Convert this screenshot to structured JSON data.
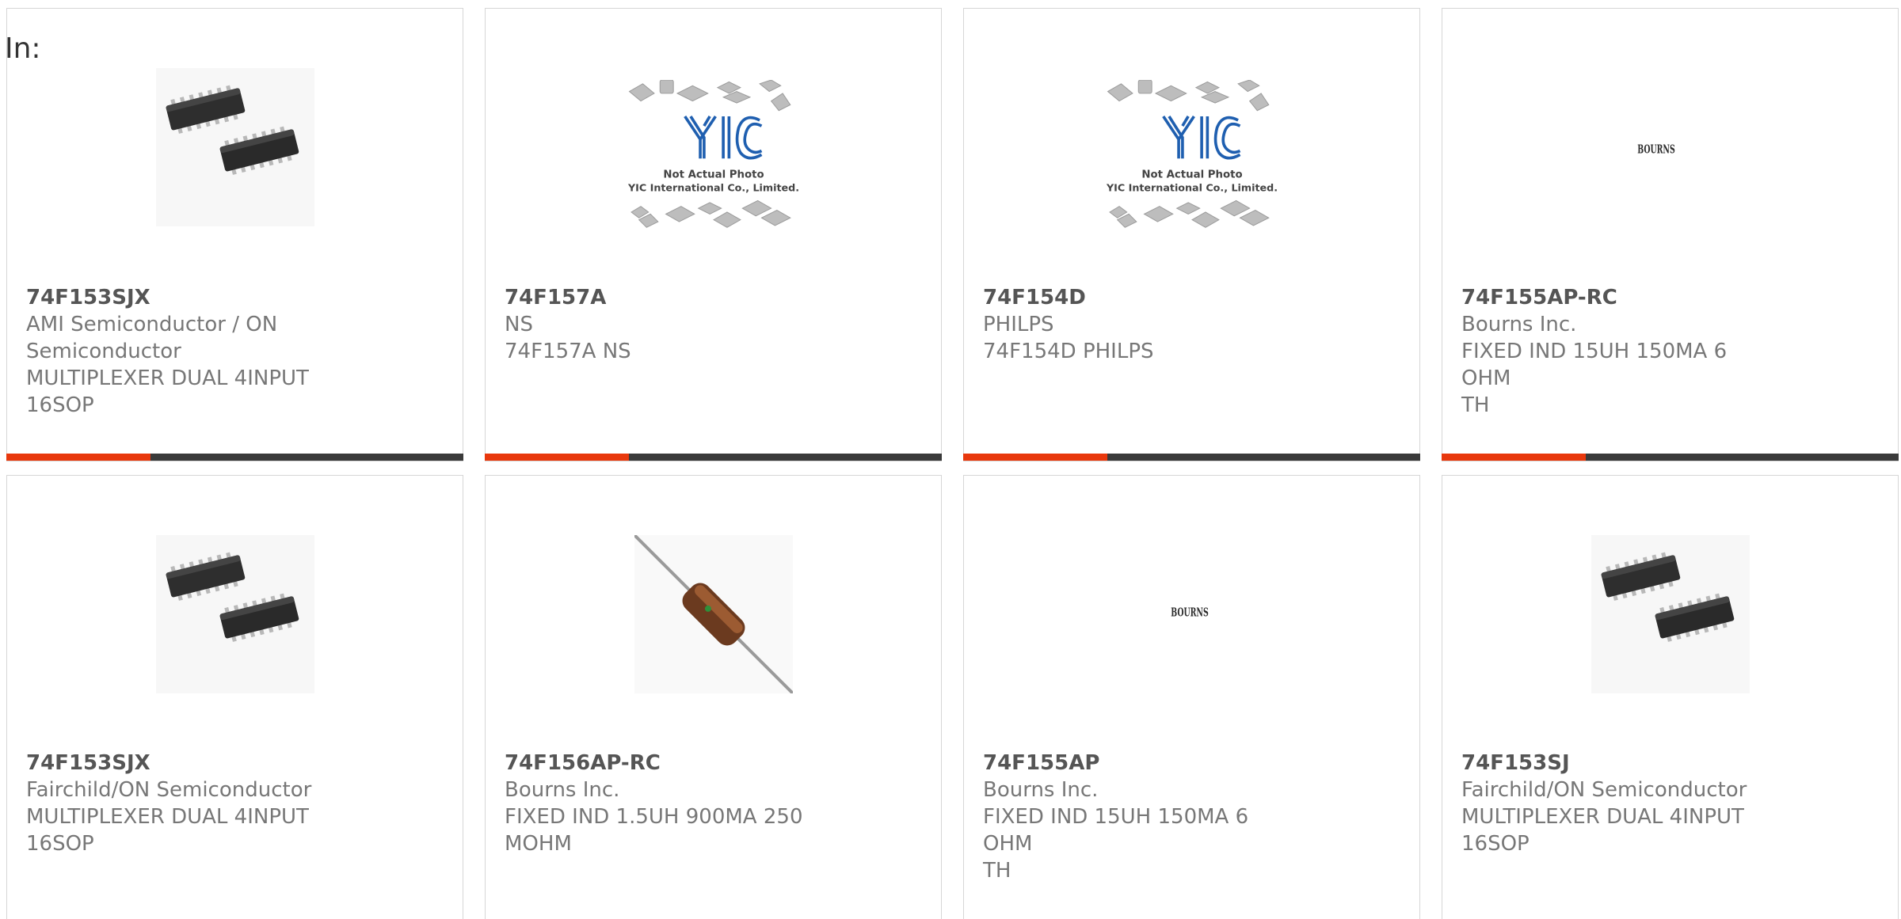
{
  "page": {
    "in_label": "In:"
  },
  "colors": {
    "accent": "#e8380d",
    "bar_dark": "#3a3a3a",
    "card_border": "#d6d6d6",
    "text_gray": "#777777"
  },
  "products": [
    {
      "part_number": "74F153SJX",
      "manufacturer_lines": [
        "AMI Semiconductor / ON",
        "Semiconductor"
      ],
      "description_lines": [
        "MULTIPLEXER DUAL 4INPUT",
        "16SOP"
      ],
      "image": "soic-chip-pair-photo"
    },
    {
      "part_number": "74F157A",
      "manufacturer_lines": [
        "NS"
      ],
      "description_lines": [
        "74F157A NS"
      ],
      "image": "yic-not-actual-photo",
      "image_text": [
        "YIC",
        "Not Actual Photo",
        "YIC International Co., Limited."
      ]
    },
    {
      "part_number": "74F154D",
      "manufacturer_lines": [
        "PHILPS"
      ],
      "description_lines": [
        "74F154D PHILPS"
      ],
      "image": "yic-not-actual-photo",
      "image_text": [
        "YIC",
        "Not Actual Photo",
        "YIC International Co., Limited."
      ]
    },
    {
      "part_number": "74F155AP-RC",
      "manufacturer_lines": [
        "Bourns Inc."
      ],
      "description_lines": [
        "FIXED IND 15UH 150MA 6 OHM",
        "TH"
      ],
      "image": "bourns-logo",
      "image_text": [
        "BOURNS"
      ]
    },
    {
      "part_number": "74F153SJX",
      "manufacturer_lines": [
        "Fairchild/ON Semiconductor"
      ],
      "description_lines": [
        "MULTIPLEXER DUAL 4INPUT",
        "16SOP"
      ],
      "image": "soic-chip-pair-photo"
    },
    {
      "part_number": "74F156AP-RC",
      "manufacturer_lines": [
        "Bourns Inc."
      ],
      "description_lines": [
        "FIXED IND 1.5UH 900MA 250",
        "MOHM"
      ],
      "image": "axial-inductor-photo"
    },
    {
      "part_number": "74F155AP",
      "manufacturer_lines": [
        "Bourns Inc."
      ],
      "description_lines": [
        "FIXED IND 15UH 150MA 6 OHM",
        "TH"
      ],
      "image": "bourns-logo",
      "image_text": [
        "BOURNS"
      ]
    },
    {
      "part_number": "74F153SJ",
      "manufacturer_lines": [
        "Fairchild/ON Semiconductor"
      ],
      "description_lines": [
        "MULTIPLEXER DUAL 4INPUT",
        "16SOP"
      ],
      "image": "soic-chip-pair-photo"
    }
  ]
}
